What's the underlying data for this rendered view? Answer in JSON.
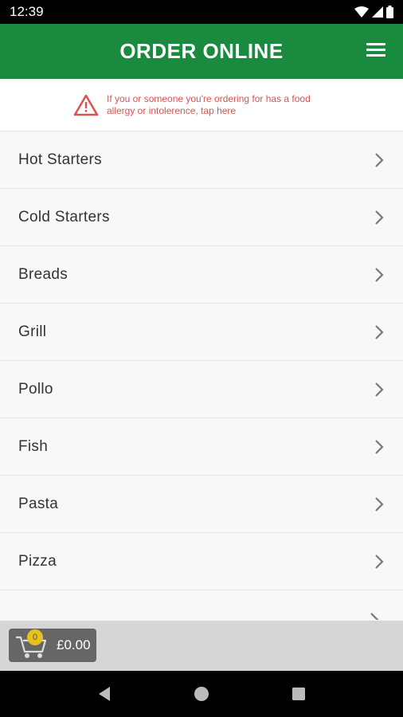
{
  "status": {
    "time": "12:39"
  },
  "header": {
    "title": "ORDER ONLINE",
    "menu_icon": "hamburger-menu-icon"
  },
  "allergy": {
    "text": "If you or someone you're ordering for has a food allergy or intolerence, tap here",
    "icon": "warning-triangle-icon",
    "color": "#d9534f"
  },
  "menu": {
    "items": [
      {
        "label": "Hot Starters"
      },
      {
        "label": "Cold Starters"
      },
      {
        "label": "Breads"
      },
      {
        "label": "Grill"
      },
      {
        "label": "Pollo"
      },
      {
        "label": "Fish"
      },
      {
        "label": "Pasta"
      },
      {
        "label": "Pizza"
      }
    ]
  },
  "cart": {
    "count": "0",
    "total": "£0.00",
    "icon": "shopping-cart-icon"
  },
  "colors": {
    "brand": "#1a8a3e",
    "badge": "#e8c21a",
    "cart_button": "#666666"
  }
}
